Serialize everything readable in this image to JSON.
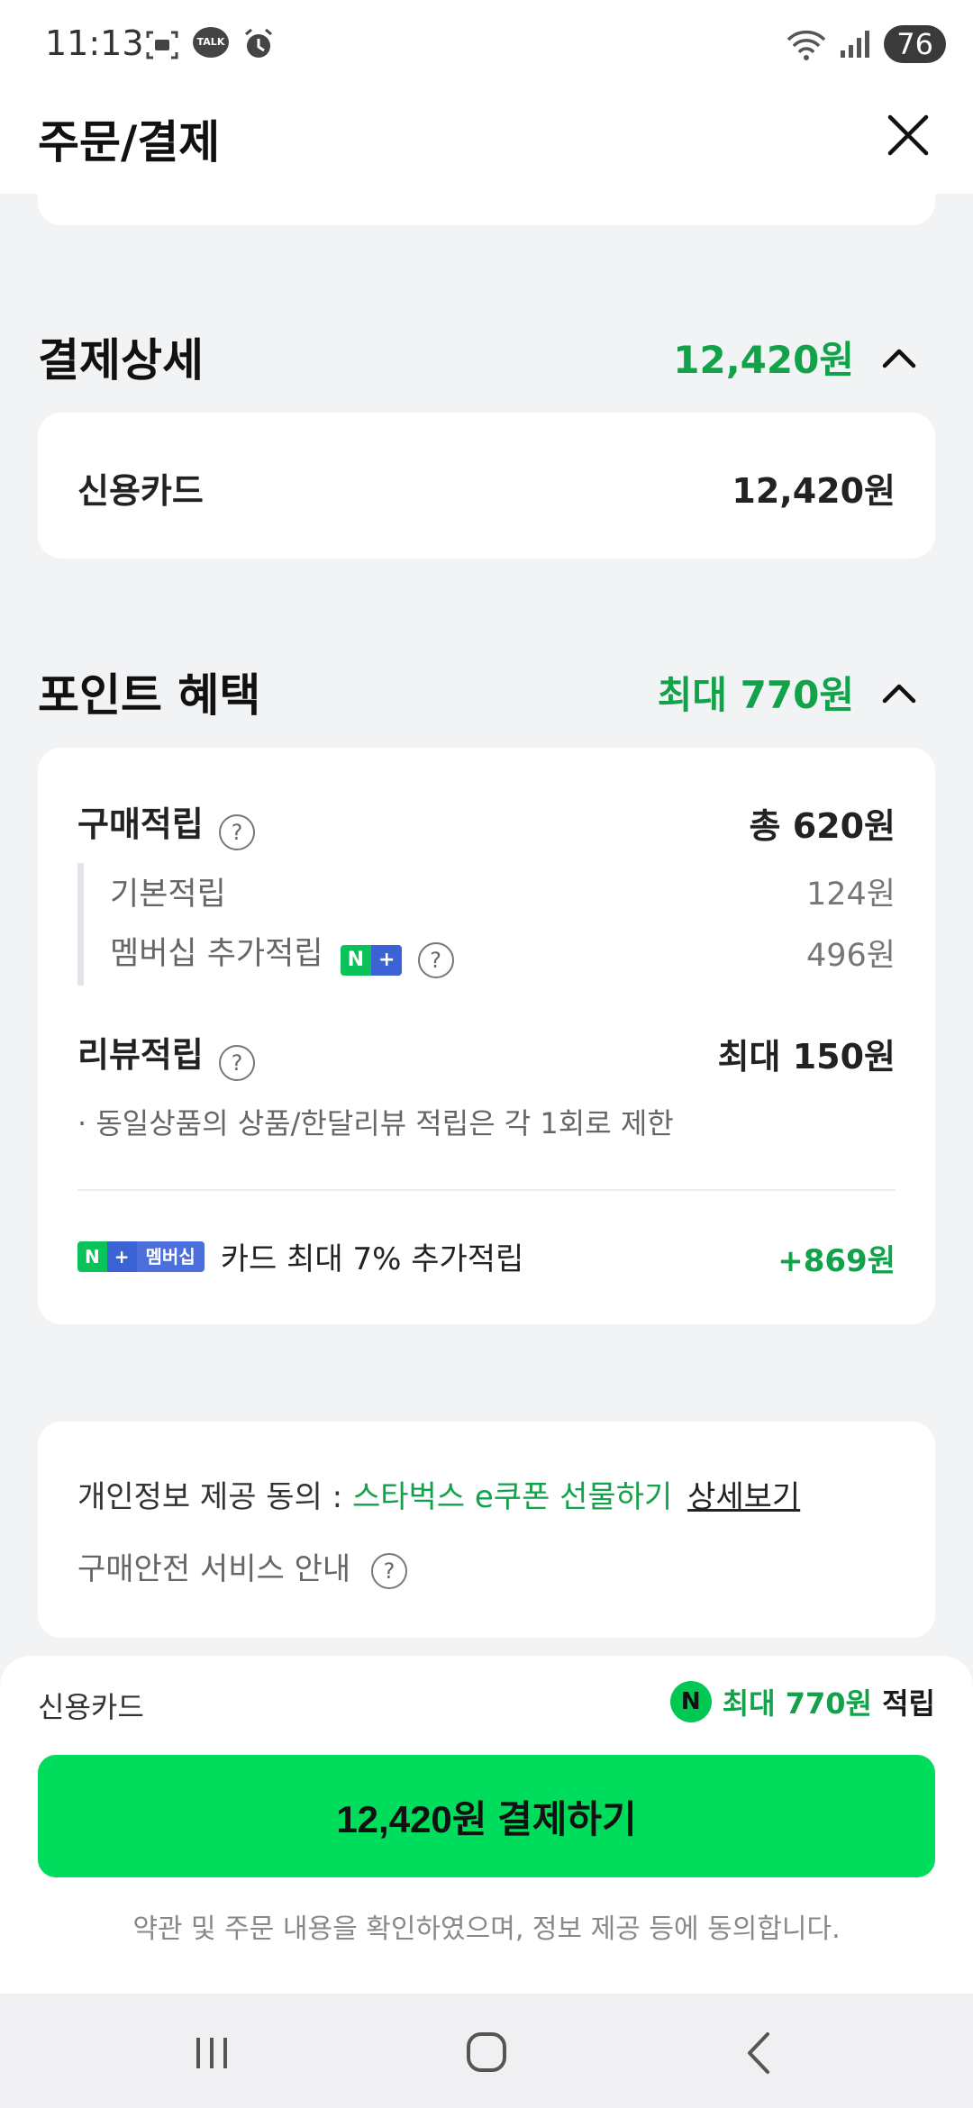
{
  "status_bar": {
    "time": "11:13",
    "talk_badge": "TALK",
    "battery": "76"
  },
  "header": {
    "title": "주문/결제"
  },
  "payment_detail": {
    "title": "결제상세",
    "total": "12,420원",
    "method_label": "신용카드",
    "method_amount": "12,420원"
  },
  "point_benefit": {
    "title": "포인트 혜택",
    "max_total": "최대 770원",
    "purchase": {
      "label": "구매적립",
      "total": "총 620원",
      "items": [
        {
          "label": "기본적립",
          "value": "124원"
        },
        {
          "label": "멤버십 추가적립",
          "value": "496원"
        }
      ]
    },
    "review": {
      "label": "리뷰적립",
      "value": "최대 150원",
      "note": "· 동일상품의 상품/한달리뷰 적립은 각 1회로 제한"
    },
    "card_bonus": {
      "badge_text": "멤버십",
      "label": "카드 최대 7% 추가적립",
      "value": "+869원"
    },
    "nplus_badge": {
      "n": "N",
      "plus": "+"
    }
  },
  "consent": {
    "prefix": "개인정보 제공 동의 : ",
    "highlight": "스타벅스 e쿠폰 선물하기",
    "detail_link": "상세보기",
    "safety_label": "구매안전 서비스 안내"
  },
  "bottom_sheet": {
    "method": "신용카드",
    "point_icon_letter": "N",
    "point_text": "최대 770원",
    "point_suffix": " 적립",
    "pay_button": "12,420원 결제하기",
    "agreement": "약관 및 주문 내용을 확인하였으며, 정보 제공 등에 동의합니다."
  },
  "colors": {
    "accent_green": "#12a24a",
    "button_green": "#00dc5c",
    "background": "#f2f3f5"
  }
}
